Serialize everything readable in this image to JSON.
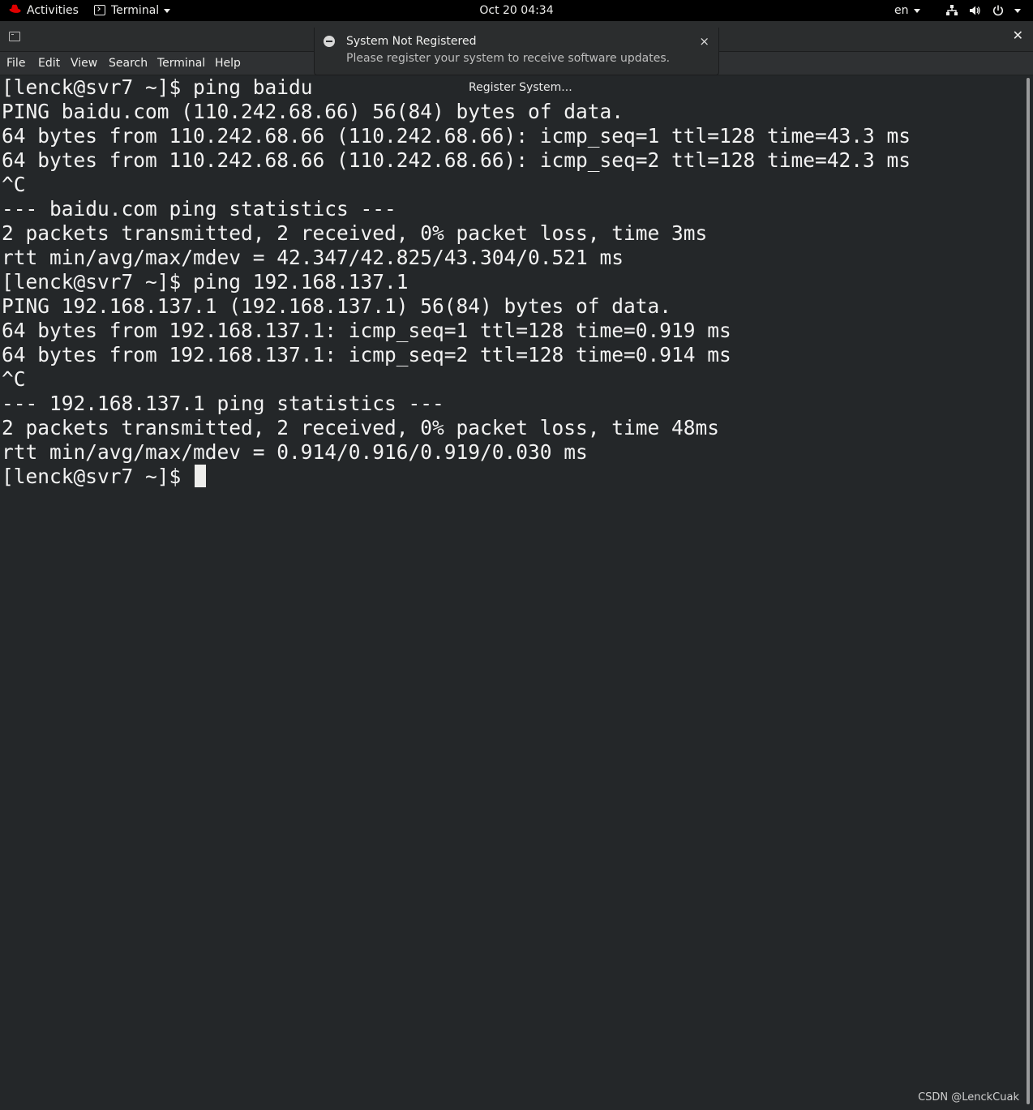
{
  "topbar": {
    "activities": "Activities",
    "app_menu": "Terminal",
    "clock": "Oct 20  04:34",
    "language": "en"
  },
  "menubar": {
    "file": "File",
    "edit": "Edit",
    "view": "View",
    "search": "Search",
    "terminal": "Terminal",
    "help": "Help"
  },
  "notification": {
    "title": "System Not Registered",
    "body": "Please register your system to receive software updates.",
    "close": "×",
    "action": "Register System..."
  },
  "terminal": {
    "lines": [
      "[lenck@svr7 ~]$ ping baidu",
      "PING baidu.com (110.242.68.66) 56(84) bytes of data.",
      "64 bytes from 110.242.68.66 (110.242.68.66): icmp_seq=1 ttl=128 time=43.3 ms",
      "64 bytes from 110.242.68.66 (110.242.68.66): icmp_seq=2 ttl=128 time=42.3 ms",
      "^C",
      "--- baidu.com ping statistics ---",
      "2 packets transmitted, 2 received, 0% packet loss, time 3ms",
      "rtt min/avg/max/mdev = 42.347/42.825/43.304/0.521 ms",
      "[lenck@svr7 ~]$ ping 192.168.137.1",
      "PING 192.168.137.1 (192.168.137.1) 56(84) bytes of data.",
      "64 bytes from 192.168.137.1: icmp_seq=1 ttl=128 time=0.919 ms",
      "64 bytes from 192.168.137.1: icmp_seq=2 ttl=128 time=0.914 ms",
      "^C",
      "--- 192.168.137.1 ping statistics ---",
      "2 packets transmitted, 2 received, 0% packet loss, time 48ms",
      "rtt min/avg/max/mdev = 0.914/0.916/0.919/0.030 ms",
      "[lenck@svr7 ~]$ "
    ]
  },
  "watermark": "CSDN @LenckCuak",
  "colors": {
    "terminal_bg": "#242729",
    "terminal_fg": "#f2f2f2",
    "topbar_bg": "#000000",
    "redhat_red": "#e00000"
  },
  "icons": [
    "redhat-logo-icon",
    "terminal-icon",
    "network-icon",
    "volume-icon",
    "power-icon",
    "close-icon",
    "notification-icon"
  ]
}
